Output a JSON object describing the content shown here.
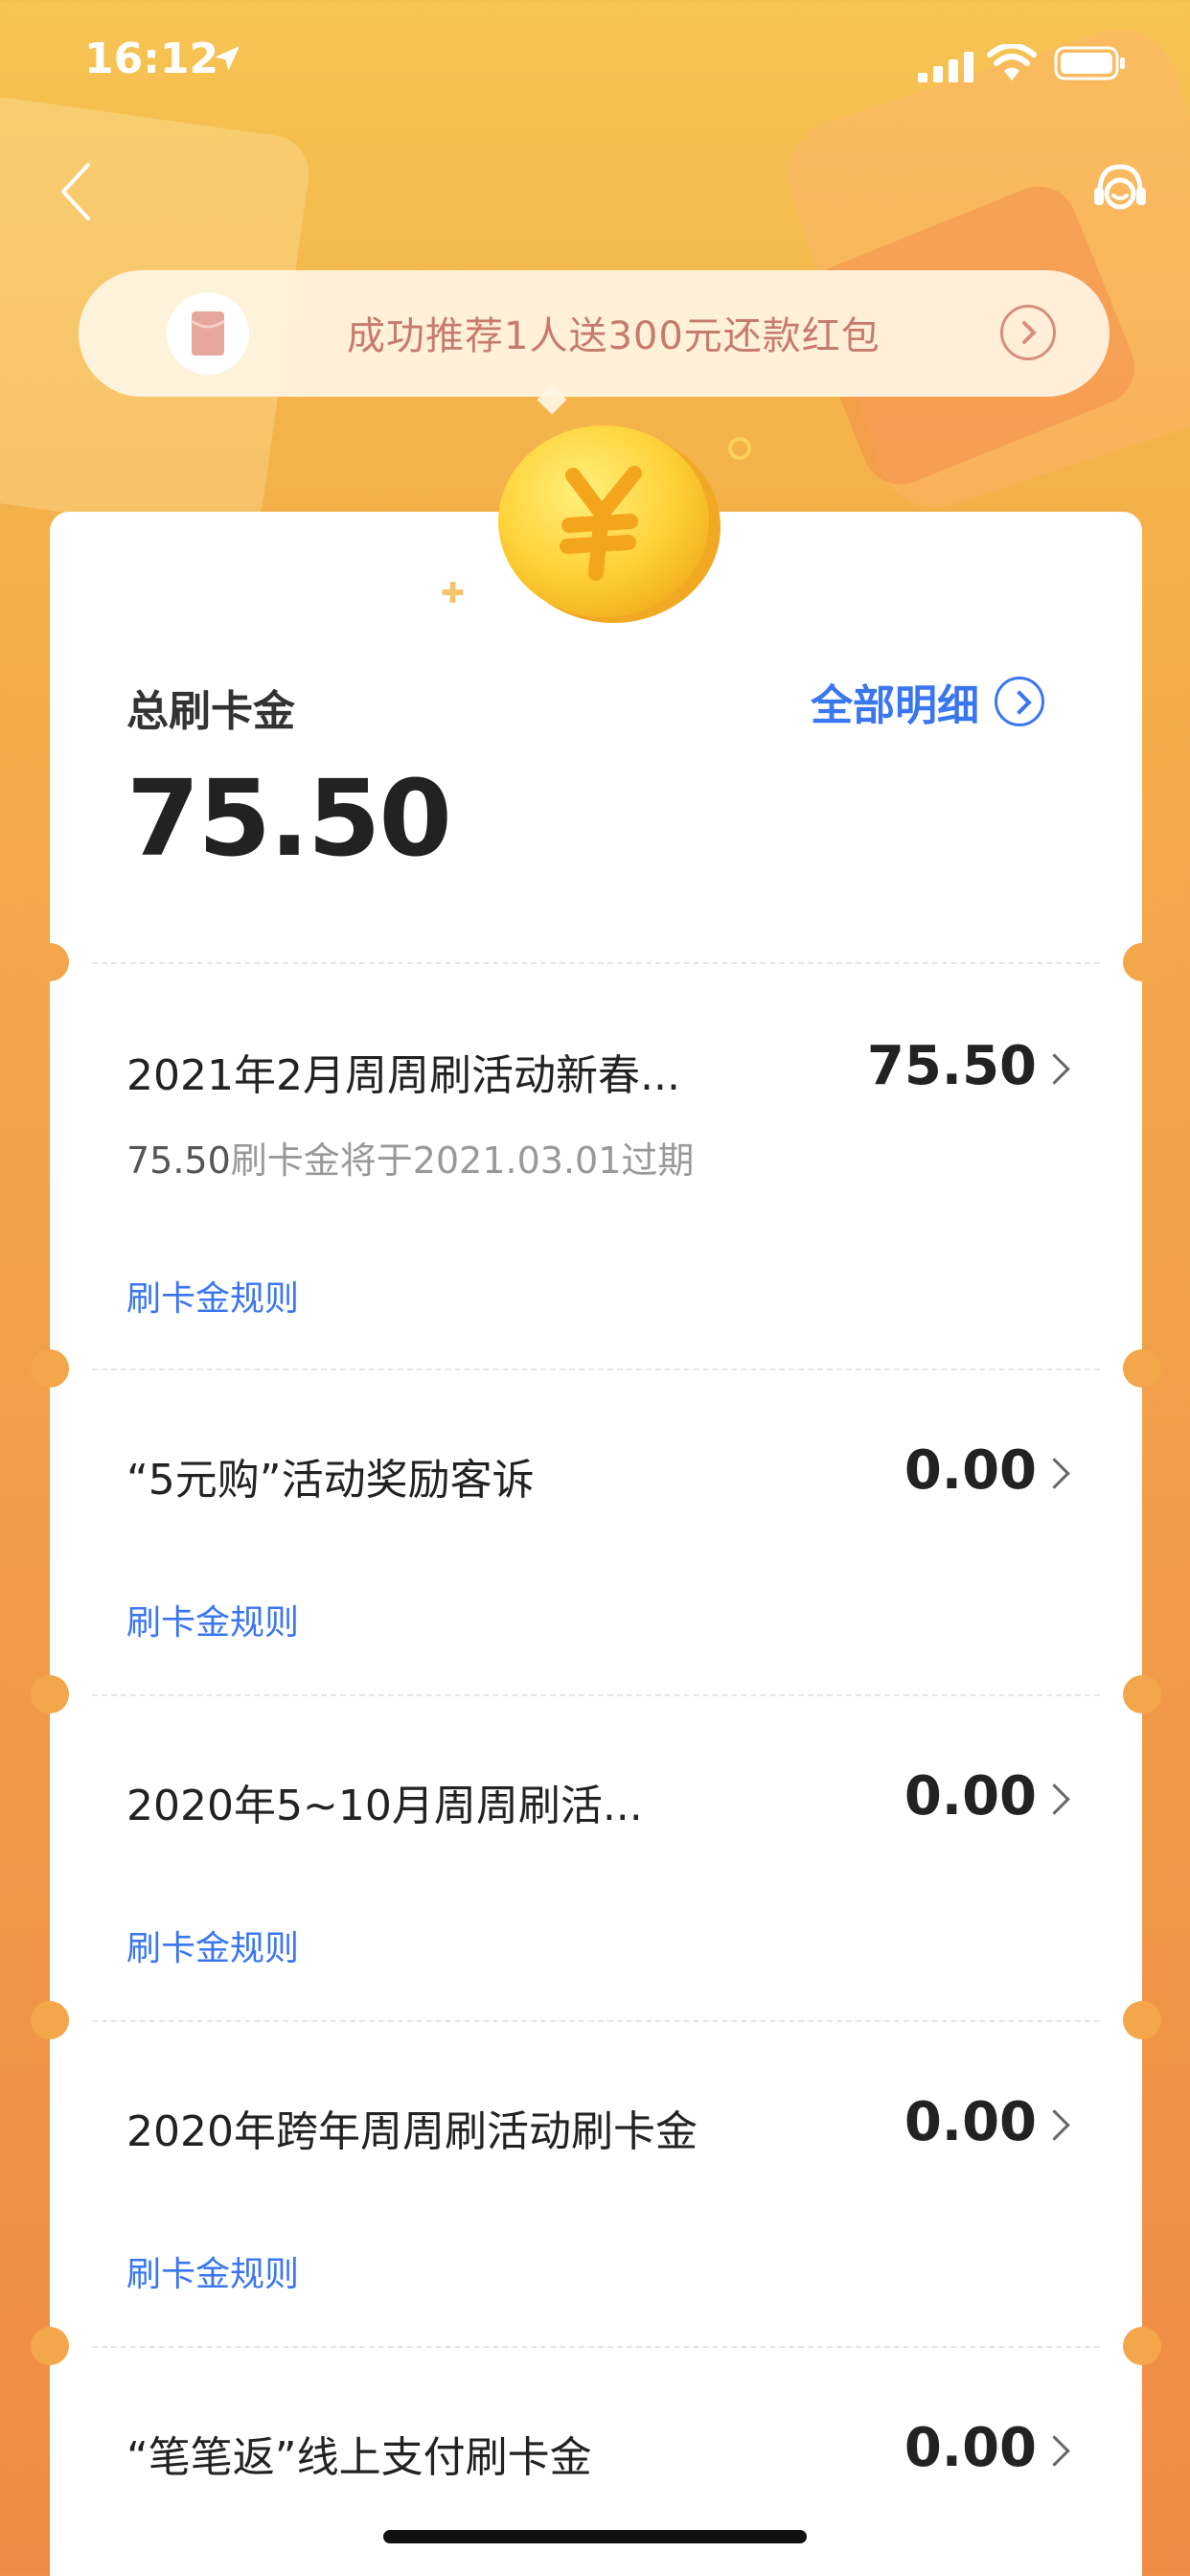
{
  "status_bar": {
    "time": "16:12"
  },
  "promo": {
    "text": "成功推荐1人送300元还款红包"
  },
  "summary": {
    "label": "总刷卡金",
    "amount": "75.50",
    "detail_link": "全部明细"
  },
  "items": [
    {
      "title": "2021年2月周周刷活动新春...",
      "amount": "75.50",
      "sub_amount": "75.50",
      "sub_text": "刷卡金将于2021.03.01过期",
      "rule": "刷卡金规则"
    },
    {
      "title": "“5元购”活动奖励客诉",
      "amount": "0.00",
      "rule": "刷卡金规则"
    },
    {
      "title": "2020年5~10月周周刷活...",
      "amount": "0.00",
      "rule": "刷卡金规则"
    },
    {
      "title": "2020年跨年周周刷活动刷卡金",
      "amount": "0.00",
      "rule": "刷卡金规则"
    },
    {
      "title": "“笔笔返”线上支付刷卡金",
      "amount": "0.00"
    }
  ],
  "colors": {
    "accent_blue": "#3a76f0",
    "promo_text": "#c77b6d",
    "bg_orange": "#f2a24b"
  }
}
